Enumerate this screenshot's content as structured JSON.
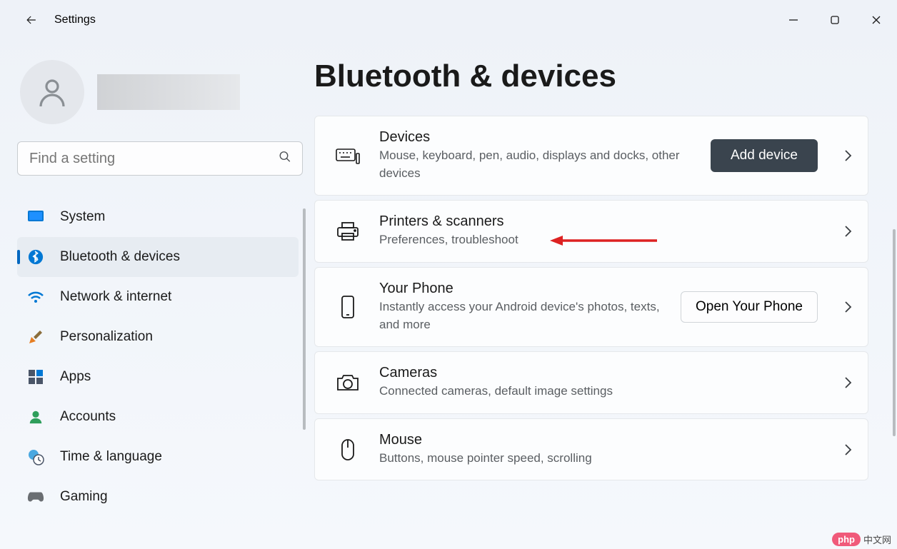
{
  "app_title": "Settings",
  "window_controls": {
    "minimize": "minimize",
    "maximize": "maximize",
    "close": "close"
  },
  "search": {
    "placeholder": "Find a setting"
  },
  "nav": {
    "items": [
      {
        "id": "system",
        "label": "System",
        "active": false
      },
      {
        "id": "bluetooth-devices",
        "label": "Bluetooth & devices",
        "active": true
      },
      {
        "id": "network-internet",
        "label": "Network & internet",
        "active": false
      },
      {
        "id": "personalization",
        "label": "Personalization",
        "active": false
      },
      {
        "id": "apps",
        "label": "Apps",
        "active": false
      },
      {
        "id": "accounts",
        "label": "Accounts",
        "active": false
      },
      {
        "id": "time-language",
        "label": "Time & language",
        "active": false
      },
      {
        "id": "gaming",
        "label": "Gaming",
        "active": false
      }
    ]
  },
  "page": {
    "title": "Bluetooth & devices",
    "cards": [
      {
        "id": "devices",
        "title": "Devices",
        "desc": "Mouse, keyboard, pen, audio, displays and docks, other devices",
        "action_label": "Add device",
        "action_style": "primary"
      },
      {
        "id": "printers-scanners",
        "title": "Printers & scanners",
        "desc": "Preferences, troubleshoot"
      },
      {
        "id": "your-phone",
        "title": "Your Phone",
        "desc": "Instantly access your Android device's photos, texts, and more",
        "action_label": "Open Your Phone",
        "action_style": "secondary"
      },
      {
        "id": "cameras",
        "title": "Cameras",
        "desc": "Connected cameras, default image settings"
      },
      {
        "id": "mouse",
        "title": "Mouse",
        "desc": "Buttons, mouse pointer speed, scrolling"
      }
    ]
  },
  "watermark": {
    "pill": "php",
    "text": "中文网"
  }
}
